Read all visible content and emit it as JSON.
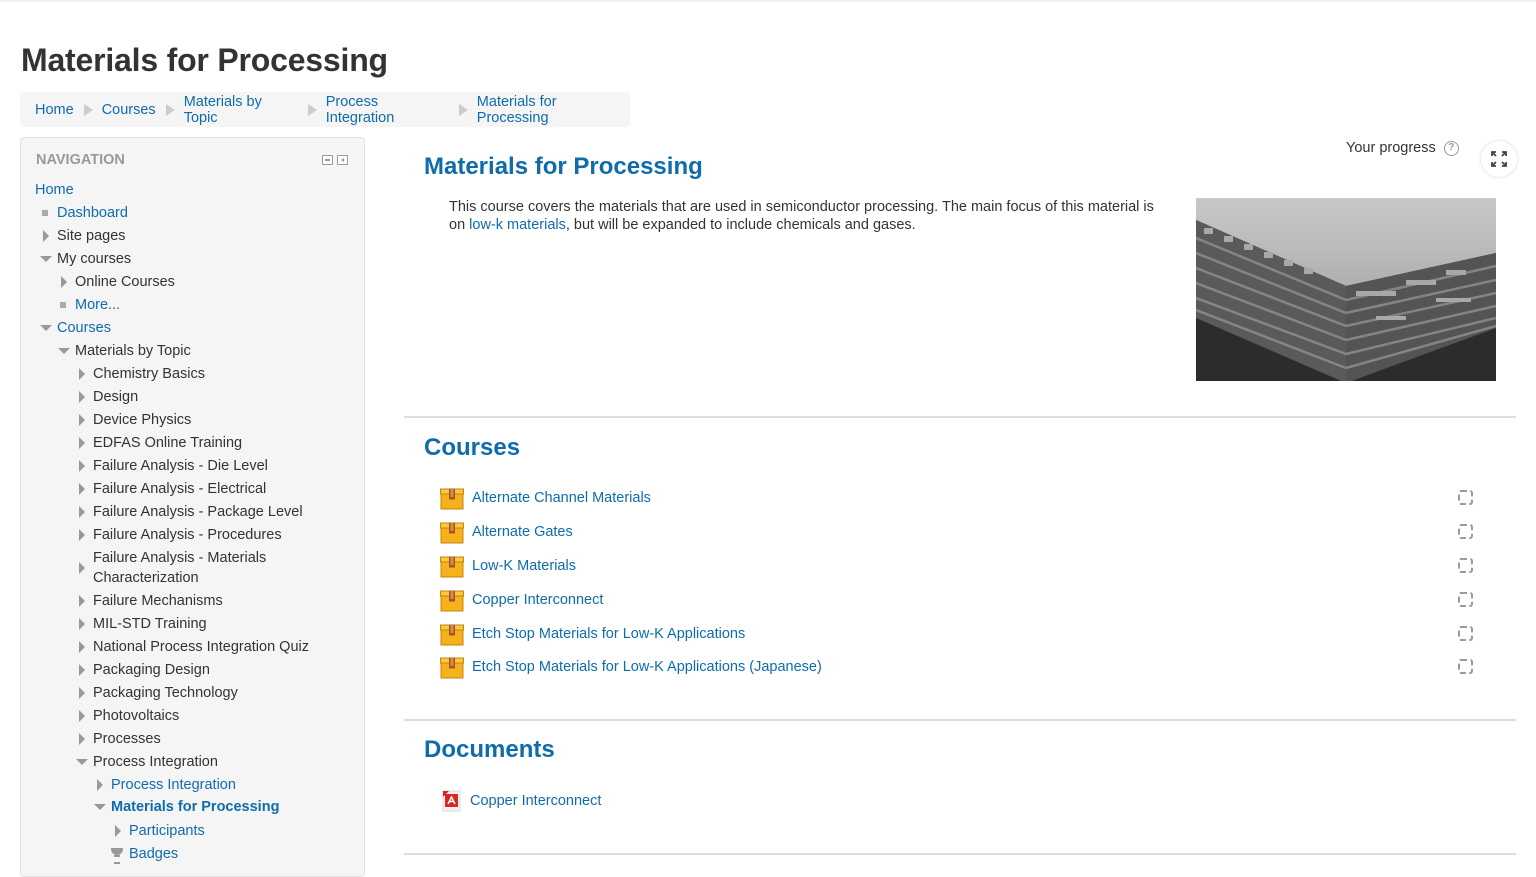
{
  "page": {
    "title": "Materials for Processing"
  },
  "breadcrumb": [
    {
      "label": "Home"
    },
    {
      "label": "Courses"
    },
    {
      "label": "Materials by Topic"
    },
    {
      "label": "Process Integration"
    },
    {
      "label": "Materials for Processing"
    }
  ],
  "navigation": {
    "title": "NAVIGATION",
    "items": [
      {
        "label": "Home",
        "marker": "none",
        "style": "link"
      },
      {
        "label": "Dashboard",
        "marker": "leaf",
        "style": "link"
      },
      {
        "label": "Site pages",
        "marker": "closed",
        "style": "text"
      },
      {
        "label": "My courses",
        "marker": "open",
        "style": "text"
      },
      {
        "label": "Online Courses",
        "marker": "closed",
        "style": "text"
      },
      {
        "label": "More...",
        "marker": "leaf",
        "style": "link"
      },
      {
        "label": "Courses",
        "marker": "open",
        "style": "link"
      },
      {
        "label": "Materials by Topic",
        "marker": "open",
        "style": "text"
      },
      {
        "label": "Chemistry Basics",
        "marker": "closed",
        "style": "text"
      },
      {
        "label": "Design",
        "marker": "closed",
        "style": "text"
      },
      {
        "label": "Device Physics",
        "marker": "closed",
        "style": "text"
      },
      {
        "label": "EDFAS Online Training",
        "marker": "closed",
        "style": "text"
      },
      {
        "label": "Failure Analysis - Die Level",
        "marker": "closed",
        "style": "text"
      },
      {
        "label": "Failure Analysis - Electrical",
        "marker": "closed",
        "style": "text"
      },
      {
        "label": "Failure Analysis - Package Level",
        "marker": "closed",
        "style": "text"
      },
      {
        "label": "Failure Analysis - Procedures",
        "marker": "closed",
        "style": "text"
      },
      {
        "label": "Failure Analysis - Materials",
        "label2": "Characterization",
        "marker": "closed",
        "style": "text"
      },
      {
        "label": "Failure Mechanisms",
        "marker": "closed",
        "style": "text"
      },
      {
        "label": "MIL-STD Training",
        "marker": "closed",
        "style": "text"
      },
      {
        "label": "National Process Integration Quiz",
        "marker": "closed",
        "style": "text"
      },
      {
        "label": "Packaging Design",
        "marker": "closed",
        "style": "text"
      },
      {
        "label": "Packaging Technology",
        "marker": "closed",
        "style": "text"
      },
      {
        "label": "Photovoltaics",
        "marker": "closed",
        "style": "text"
      },
      {
        "label": "Processes",
        "marker": "closed",
        "style": "text"
      },
      {
        "label": "Process Integration",
        "marker": "open",
        "style": "text"
      },
      {
        "label": "Process Integration",
        "marker": "closed",
        "style": "link"
      },
      {
        "label": "Materials for Processing",
        "marker": "open",
        "style": "link-bold"
      },
      {
        "label": "Participants",
        "marker": "closed",
        "style": "link"
      },
      {
        "label": "Badges",
        "marker": "trophy",
        "style": "link"
      }
    ]
  },
  "course": {
    "heading": "Materials for Processing",
    "summary_part1": "This course covers the materials that are used in semiconductor processing. The main focus of this material is on ",
    "summary_link": "low-k materials",
    "summary_part2": ", but will be expanded to include chemicals and gases.",
    "progress_label": "Your progress",
    "help_glyph": "?",
    "image_alt": "Semiconductor cross-section SEM image"
  },
  "sections": {
    "courses": {
      "title": "Courses",
      "items": [
        {
          "label": "Alternate Channel Materials",
          "icon": "package-icon",
          "completed": false
        },
        {
          "label": "Alternate Gates",
          "icon": "package-icon",
          "completed": false
        },
        {
          "label": "Low-K Materials",
          "icon": "package-icon",
          "completed": false
        },
        {
          "label": "Copper Interconnect",
          "icon": "package-icon",
          "completed": false
        },
        {
          "label": "Etch Stop Materials for Low-K Applications",
          "icon": "package-icon",
          "completed": false
        },
        {
          "label": "Etch Stop Materials for Low-K Applications (Japanese)",
          "icon": "package-icon",
          "completed": false
        }
      ]
    },
    "documents": {
      "title": "Documents",
      "items": [
        {
          "label": "Copper Interconnect",
          "icon": "pdf-icon"
        }
      ]
    }
  },
  "colors": {
    "link": "#0f6cab",
    "text": "#333333",
    "nav_bg": "#f5f5f5",
    "package_orange": "#f5a623"
  }
}
